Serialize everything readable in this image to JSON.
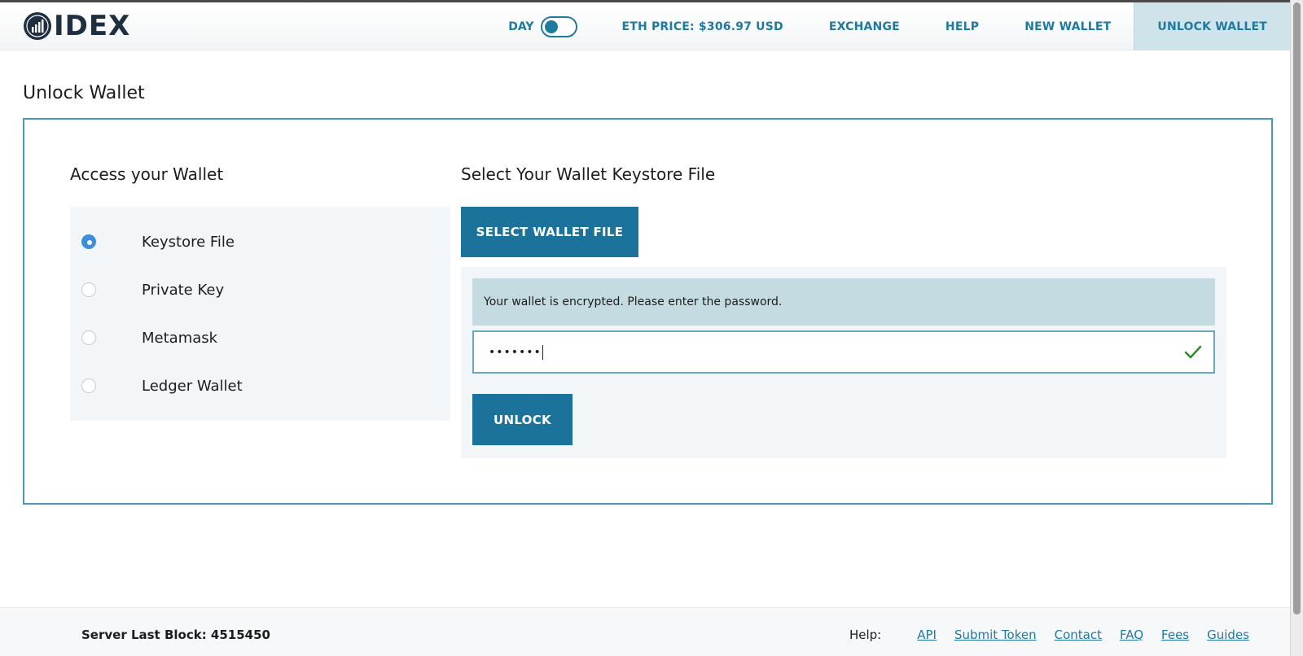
{
  "header": {
    "logo_text": "IDEX",
    "theme_label": "DAY",
    "eth_price": "ETH PRICE: $306.97 USD",
    "nav": [
      "EXCHANGE",
      "HELP",
      "NEW WALLET",
      "UNLOCK WALLET"
    ],
    "active_nav": "UNLOCK WALLET"
  },
  "page": {
    "title": "Unlock Wallet"
  },
  "access": {
    "title": "Access your Wallet",
    "methods": [
      "Keystore File",
      "Private Key",
      "Metamask",
      "Ledger Wallet"
    ],
    "selected": "Keystore File"
  },
  "keystore": {
    "title": "Select Your Wallet Keystore File",
    "select_button": "SELECT WALLET FILE",
    "notice": "Your wallet is encrypted. Please enter the password.",
    "password_value": "•••••••",
    "unlock_button": "UNLOCK"
  },
  "footer": {
    "server_last_block": "Server Last Block: 4515450",
    "help_label": "Help:",
    "links": [
      "API",
      "Submit Token",
      "Contact",
      "FAQ",
      "Fees",
      "Guides"
    ]
  },
  "colors": {
    "accent": "#1b729b",
    "nav_text": "#1f7aa0",
    "active_nav_bg": "#cfe3ea",
    "card_border": "#4c9bb4",
    "check": "#2e8b2e"
  }
}
